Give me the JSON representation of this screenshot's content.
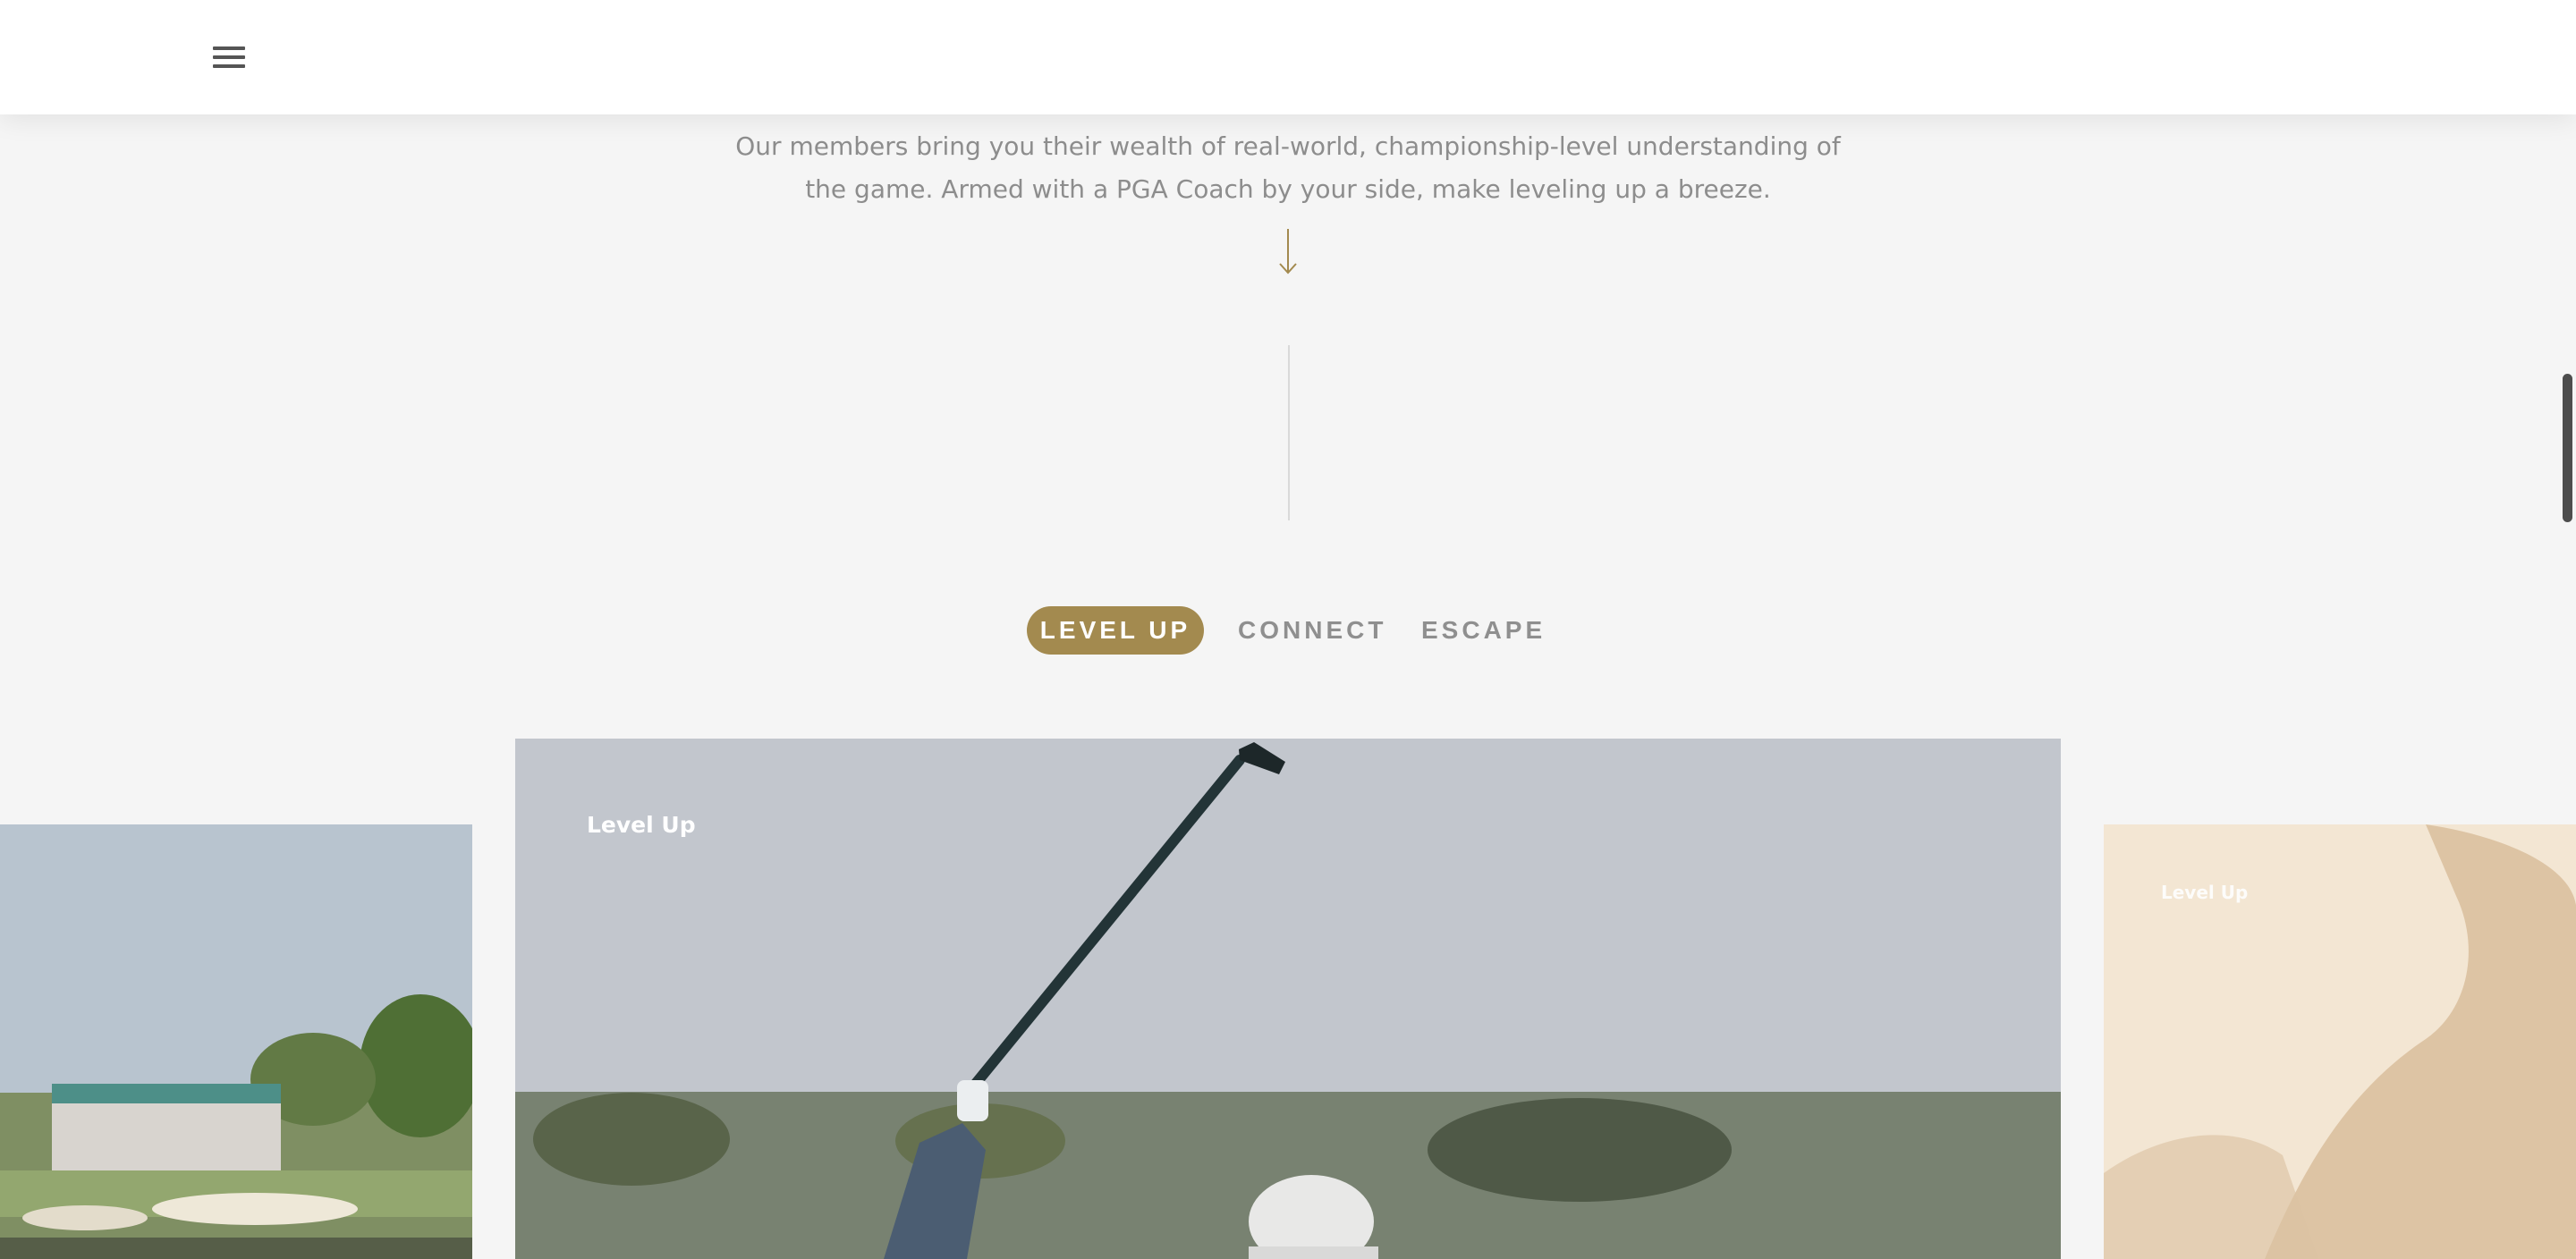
{
  "header": {
    "menu_icon": "hamburger-menu-icon"
  },
  "intro": {
    "text": "Our members bring you their wealth of real-world, championship-level understanding of the game. Armed with a PGA Coach by your side, make leveling up a breeze."
  },
  "arrow_icon": "down-arrow-icon",
  "tabs": [
    {
      "label": "LEVEL UP",
      "active": true
    },
    {
      "label": "CONNECT",
      "active": false
    },
    {
      "label": "ESCAPE",
      "active": false
    }
  ],
  "carousel": {
    "cards": [
      {
        "label": "",
        "image": "golf-course-grandstand-photo"
      },
      {
        "label": "Level Up",
        "image": "golfer-swinging-club-photo"
      },
      {
        "label": "Level Up",
        "image": "golfer-sunset-silhouette-photo"
      }
    ]
  },
  "colors": {
    "accent": "#a38a4f",
    "background": "#f5f5f5",
    "header_bg": "#ffffff",
    "muted_text": "#8d8d8d",
    "tab_inactive": "#8f8f8f"
  }
}
